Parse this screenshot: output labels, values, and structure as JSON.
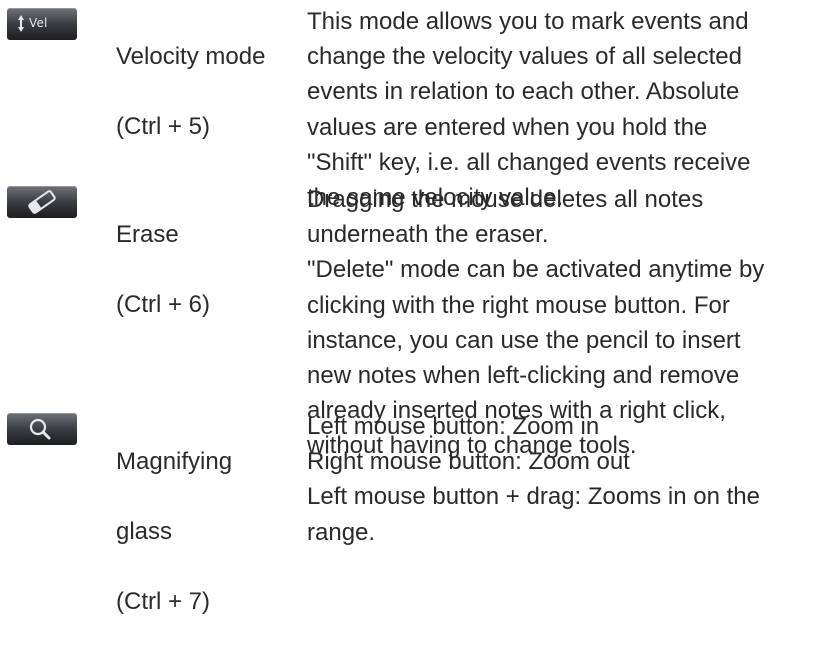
{
  "tools": [
    {
      "icon": "velocity-icon",
      "icon_label": "Vel",
      "name_lines": [
        "Velocity mode",
        "(Ctrl + 5)"
      ],
      "description_lines": [
        "This mode allows you to mark events and",
        "change the velocity values of all selected",
        "events in relation to each other. Absolute",
        "values are entered when you hold the",
        "\"Shift\" key, i.e. all changed events receive",
        "the same velocity value."
      ]
    },
    {
      "icon": "eraser-icon",
      "name_lines": [
        "Erase",
        "(Ctrl + 6)"
      ],
      "description_lines": [
        "Dragging the mouse deletes all notes",
        "underneath the eraser.",
        "\"Delete\" mode can be activated anytime by",
        "clicking with the right mouse button. For",
        "instance, you can use the pencil to insert",
        "new notes when left-clicking and remove",
        "already inserted notes with a right click,",
        "without having to change tools."
      ]
    },
    {
      "icon": "magnifying-glass-icon",
      "name_lines": [
        "Magnifying",
        "glass",
        "(Ctrl + 7)"
      ],
      "description_lines": [
        "Left mouse button: Zoom in",
        "Right mouse button: Zoom out",
        "Left mouse button + drag: Zooms in on the",
        "range."
      ]
    }
  ],
  "colors": {
    "text": "#2a2a2a",
    "icon_bg_top": "#6f7379",
    "icon_bg_bottom": "#1c1e21",
    "icon_fg": "#e8e8e8"
  }
}
